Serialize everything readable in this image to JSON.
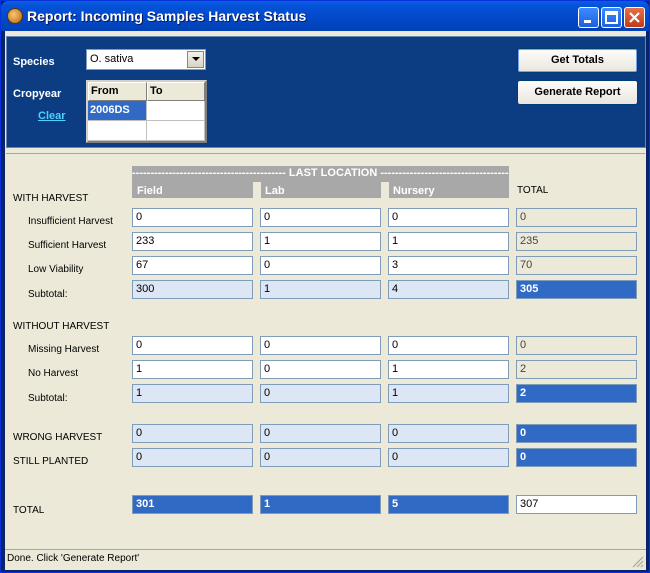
{
  "window": {
    "title": "Report: Incoming Samples Harvest Status"
  },
  "filters": {
    "species_label": "Species",
    "species_value": "O. sativa",
    "cropyear_label": "Cropyear",
    "clear_label": "Clear",
    "grid_headers": [
      "From",
      "To"
    ],
    "grid_rows": [
      [
        "2006DS",
        ""
      ],
      [
        "",
        ""
      ]
    ]
  },
  "buttons": {
    "get_totals": "Get Totals",
    "generate_report": "Generate Report"
  },
  "report": {
    "last_location": "------------------------------------------ LAST LOCATION ------------------------------------------",
    "columns": [
      "Field",
      "Lab",
      "Nursery"
    ],
    "total_col": "TOTAL",
    "with_harvest": "WITH HARVEST",
    "without_harvest": "WITHOUT HARVEST",
    "rows": {
      "insufficient": {
        "label": "Insufficient Harvest",
        "values": [
          "0",
          "0",
          "0"
        ],
        "total": "0"
      },
      "sufficient": {
        "label": "Sufficient Harvest",
        "values": [
          "233",
          "1",
          "1"
        ],
        "total": "235"
      },
      "low_viability": {
        "label": "Low Viability",
        "values": [
          "67",
          "0",
          "3"
        ],
        "total": "70"
      },
      "subtotal1": {
        "label": "Subtotal:",
        "values": [
          "300",
          "1",
          "4"
        ],
        "total": "305"
      },
      "missing": {
        "label": "Missing Harvest",
        "values": [
          "0",
          "0",
          "0"
        ],
        "total": "0"
      },
      "no_harvest": {
        "label": "No Harvest",
        "values": [
          "1",
          "0",
          "1"
        ],
        "total": "2"
      },
      "subtotal2": {
        "label": "Subtotal:",
        "values": [
          "1",
          "0",
          "1"
        ],
        "total": "2"
      },
      "wrong": {
        "label": "WRONG HARVEST",
        "values": [
          "0",
          "0",
          "0"
        ],
        "total": "0"
      },
      "still": {
        "label": "STILL PLANTED",
        "values": [
          "0",
          "0",
          "0"
        ],
        "total": "0"
      },
      "grand": {
        "label": "TOTAL",
        "values": [
          "301",
          "1",
          "5"
        ],
        "total": "307"
      }
    }
  },
  "status": {
    "text": "Done. Click 'Generate Report'"
  },
  "colors": {
    "title_blue": "#0453d9",
    "panel_blue": "#0c3d82",
    "highlight": "#316ac5",
    "link": "#4fd0ff"
  }
}
